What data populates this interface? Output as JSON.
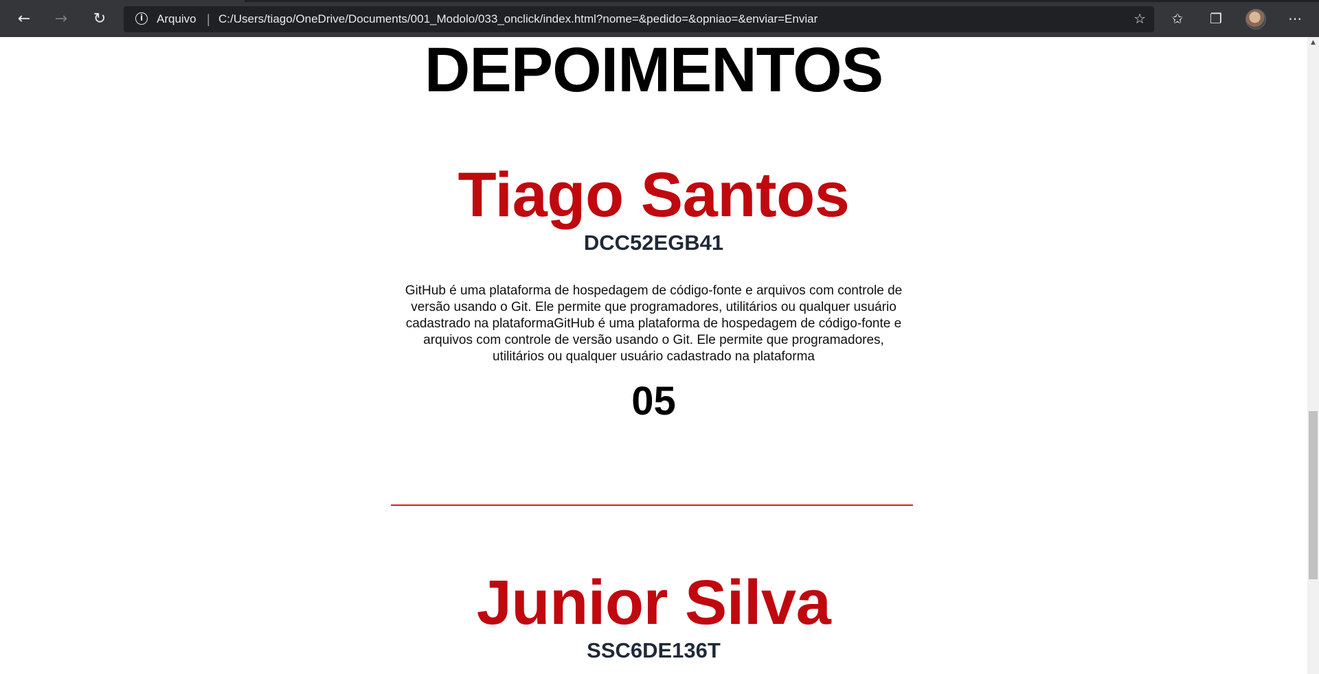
{
  "browser": {
    "back_icon": "arrow-left-icon",
    "forward_icon": "arrow-right-icon",
    "reload_icon": "reload-icon",
    "scheme_label": "Arquivo",
    "url": "C:/Users/tiago/OneDrive/Documents/001_Modolo/033_onclick/index.html?nome=&pedido=&opniao=&enviar=Enviar",
    "toolbar_icons": [
      "favorite-star-icon",
      "favorites-icon",
      "collections-icon",
      "profile-avatar",
      "more-menu-icon"
    ]
  },
  "page": {
    "heading": "DEPOIMENTOS",
    "testimonials": [
      {
        "name": "Tiago Santos",
        "code": "DCC52EGB41",
        "text": "GitHub é uma plataforma de hospedagem de código-fonte e arquivos com controle de versão usando o Git. Ele permite que programadores, utilitários ou qualquer usuário cadastrado na plataformaGitHub é uma plataforma de hospedagem de código-fonte e arquivos com controle de versão usando o Git. Ele permite que programadores, utilitários ou qualquer usuário cadastrado na plataforma",
        "rating": "05"
      },
      {
        "name": "Junior Silva",
        "code": "SSC6DE136T"
      }
    ]
  },
  "colors": {
    "accent_red": "#c0080f",
    "divider_red": "#d81e1e",
    "toolbar_bg": "#35363a",
    "omnibox_bg": "#202124"
  }
}
